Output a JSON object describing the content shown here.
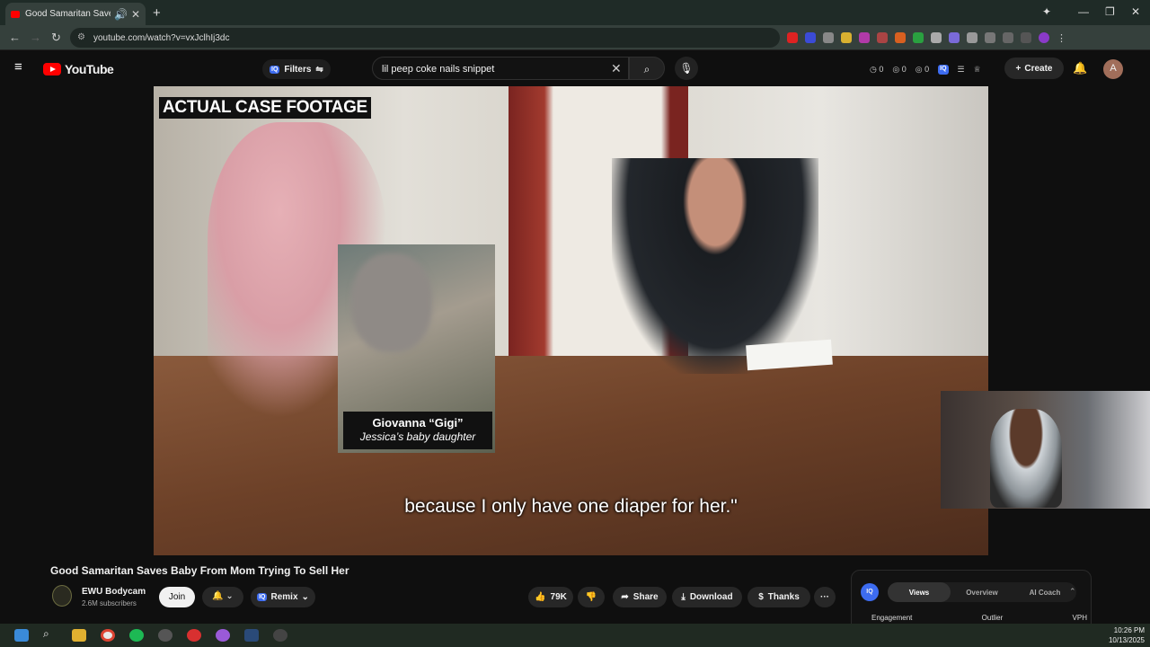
{
  "browser": {
    "tab_title": "Good Samaritan Saves Baby",
    "url": "youtube.com/watch?v=vxJclhIj3dc"
  },
  "youtube": {
    "logo": "YouTube",
    "filters_label": "Filters",
    "search_value": "lil peep coke nails snippet",
    "stats": [
      "0",
      "0",
      "0"
    ],
    "create_label": "Create",
    "avatar_letter": "A"
  },
  "video": {
    "overlay_title": "ACTUAL CASE FOOTAGE",
    "inset_name": "Giovanna “Gigi”",
    "inset_sub": "Jessica’s baby daughter",
    "subtitle": "because I only have one diaper for her.\""
  },
  "meta": {
    "title": "Good Samaritan Saves Baby From Mom Trying To Sell Her",
    "channel": "EWU Bodycam",
    "subscribers": "2.6M subscribers",
    "join_label": "Join",
    "remix_label": "Remix",
    "likes": "79K",
    "share_label": "Share",
    "download_label": "Download",
    "thanks_label": "Thanks",
    "more_label": "···"
  },
  "iq_panel": {
    "tabs": [
      "Views",
      "Overview",
      "AI Coach"
    ],
    "columns": [
      "Engagement",
      "Outlier",
      "VPH"
    ]
  },
  "taskbar": {
    "time": "10:26 PM",
    "date": "10/13/2025"
  }
}
